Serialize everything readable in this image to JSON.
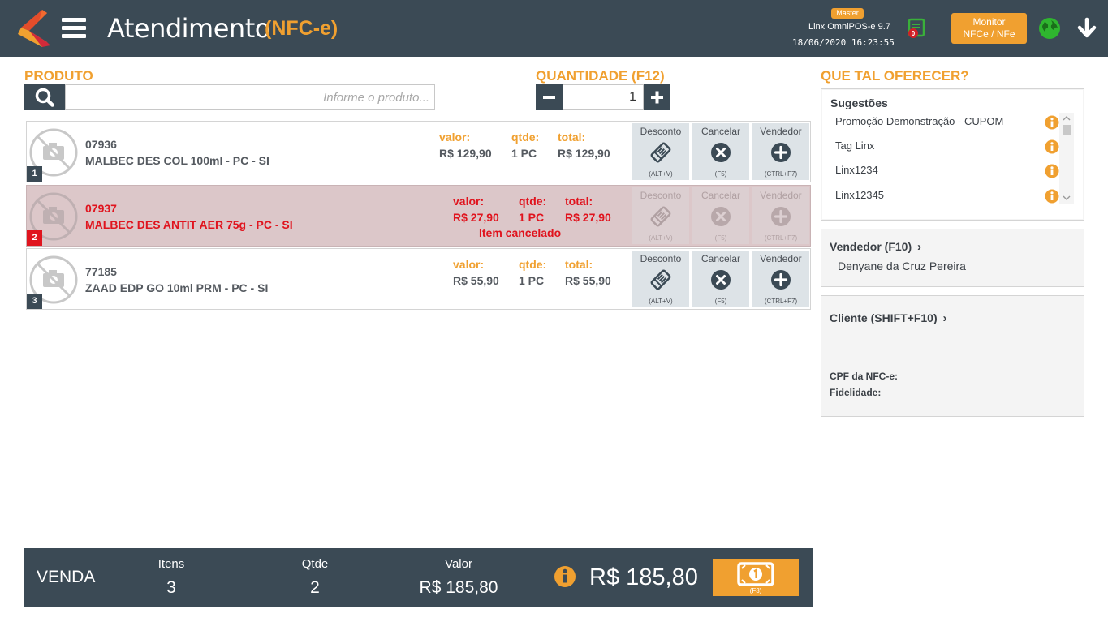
{
  "header": {
    "title": "Atendimento",
    "subtitle": "(NFC-e)",
    "badge": "Master",
    "version": "Linx OmniPOS-e  9.7",
    "datetime": "18/06/2020 16:23:55",
    "sync_count": "0",
    "monitor_line1": "Monitor",
    "monitor_line2": "NFCe / NFe"
  },
  "product": {
    "label": "PRODUTO",
    "placeholder": "Informe o produto..."
  },
  "quantity": {
    "label": "QUANTIDADE (F12)",
    "value": "1"
  },
  "item_labels": {
    "valor": "valor:",
    "qtde": "qtde:",
    "total": "total:",
    "desconto": "Desconto",
    "desconto_keys": "(ALT+V)",
    "cancelar": "Cancelar",
    "cancelar_keys": "(F5)",
    "vendedor": "Vendedor",
    "vendedor_keys": "(CTRL+F7)"
  },
  "items": [
    {
      "num": "1",
      "code": "07936",
      "name": "MALBEC DES COL 100ml - PC - SI",
      "valor": "R$ 129,90",
      "qtde": "1 PC",
      "total": "R$ 129,90",
      "status": ""
    },
    {
      "num": "2",
      "code": "07937",
      "name": "MALBEC DES ANTIT AER 75g - PC - SI",
      "valor": "R$ 27,90",
      "qtde": "1 PC",
      "total": "R$ 27,90",
      "status": "Item cancelado"
    },
    {
      "num": "3",
      "code": "77185",
      "name": "ZAAD EDP GO 10ml PRM - PC - SI",
      "valor": "R$ 55,90",
      "qtde": "1 PC",
      "total": "R$ 55,90",
      "status": ""
    }
  ],
  "offer": {
    "label": "QUE TAL OFERECER?",
    "title": "Sugestões",
    "suggestions": [
      "Promoção Demonstração - CUPOM",
      "Tag Linx",
      "Linx1234",
      "Linx12345"
    ]
  },
  "seller": {
    "title": "Vendedor (F10)",
    "name": "Denyane da Cruz Pereira"
  },
  "client": {
    "title": "Cliente (SHIFT+F10)",
    "cpf_label": "CPF da NFC-e:",
    "fidelidade_label": "Fidelidade:"
  },
  "footer": {
    "venda": "VENDA",
    "itens_label": "Itens",
    "itens_value": "3",
    "qtde_label": "Qtde",
    "qtde_value": "2",
    "valor_label": "Valor",
    "valor_value": "R$ 185,80",
    "total": "R$ 185,80",
    "pay_keys": "(F3)"
  },
  "colors": {
    "header_bg": "#3b4a55",
    "accent": "#f0a030",
    "cancel_red": "#e0141e",
    "cancel_row_bg": "#dcc7c9"
  }
}
